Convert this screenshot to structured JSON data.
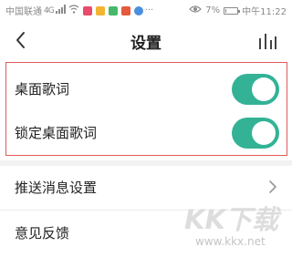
{
  "status_bar": {
    "carrier": "中国联通",
    "network": "4G",
    "battery_text": "7%",
    "time_text": "中午11:22",
    "battery_level": 0.07
  },
  "header": {
    "title": "设置",
    "back_icon": "back-arrow-icon",
    "right_icon": "equalizer-icon"
  },
  "settings": {
    "desktop_lyrics_label": "桌面歌词",
    "desktop_lyrics_on": true,
    "lock_lyrics_label": "锁定桌面歌词",
    "lock_lyrics_on": true,
    "push_label": "推送消息设置",
    "feedback_label": "意见反馈"
  },
  "colors": {
    "toggle_on": "#33b296",
    "highlight_border": "#e05a5a"
  }
}
